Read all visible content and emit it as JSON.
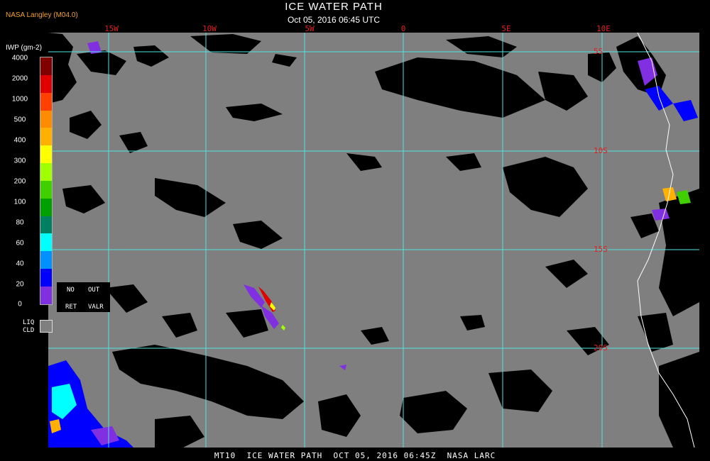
{
  "header": {
    "credit": "NASA Langley (M04.0)",
    "title": "ICE WATER PATH",
    "subtitle": "Oct 05, 2016 06:45 UTC"
  },
  "map": {
    "background_color": "#7f7f7f",
    "cloud_free_color": "#000000",
    "grid_color": "#4fe3e3",
    "coast_color": "#ffffff",
    "label_color": "#e02020",
    "longitude_labels": [
      "15W",
      "10W",
      "5W",
      "0",
      "5E",
      "10E"
    ],
    "latitude_labels": [
      "5S",
      "10S",
      "15S",
      "20S"
    ]
  },
  "legend": {
    "title": "IWP (gm-2)",
    "ticks": [
      "4000",
      "2000",
      "1000",
      "500",
      "400",
      "300",
      "200",
      "100",
      "80",
      "60",
      "40",
      "20",
      "0"
    ],
    "colors": [
      "#800000",
      "#e00000",
      "#ff4000",
      "#ff8c00",
      "#ffb000",
      "#ffff00",
      "#a0ff00",
      "#40d000",
      "#00a000",
      "#008060",
      "#00ffff",
      "#0090ff",
      "#0000ff",
      "#8030e0"
    ],
    "no_retrieval": [
      "NO",
      "RET"
    ],
    "out_value": [
      "OUT",
      "VALR"
    ],
    "liquid_cloud": [
      "LIQ",
      "CLD"
    ]
  },
  "footer": {
    "text": "MT10  ICE WATER PATH  OCT 05, 2016 06:45Z  NASA LARC"
  }
}
